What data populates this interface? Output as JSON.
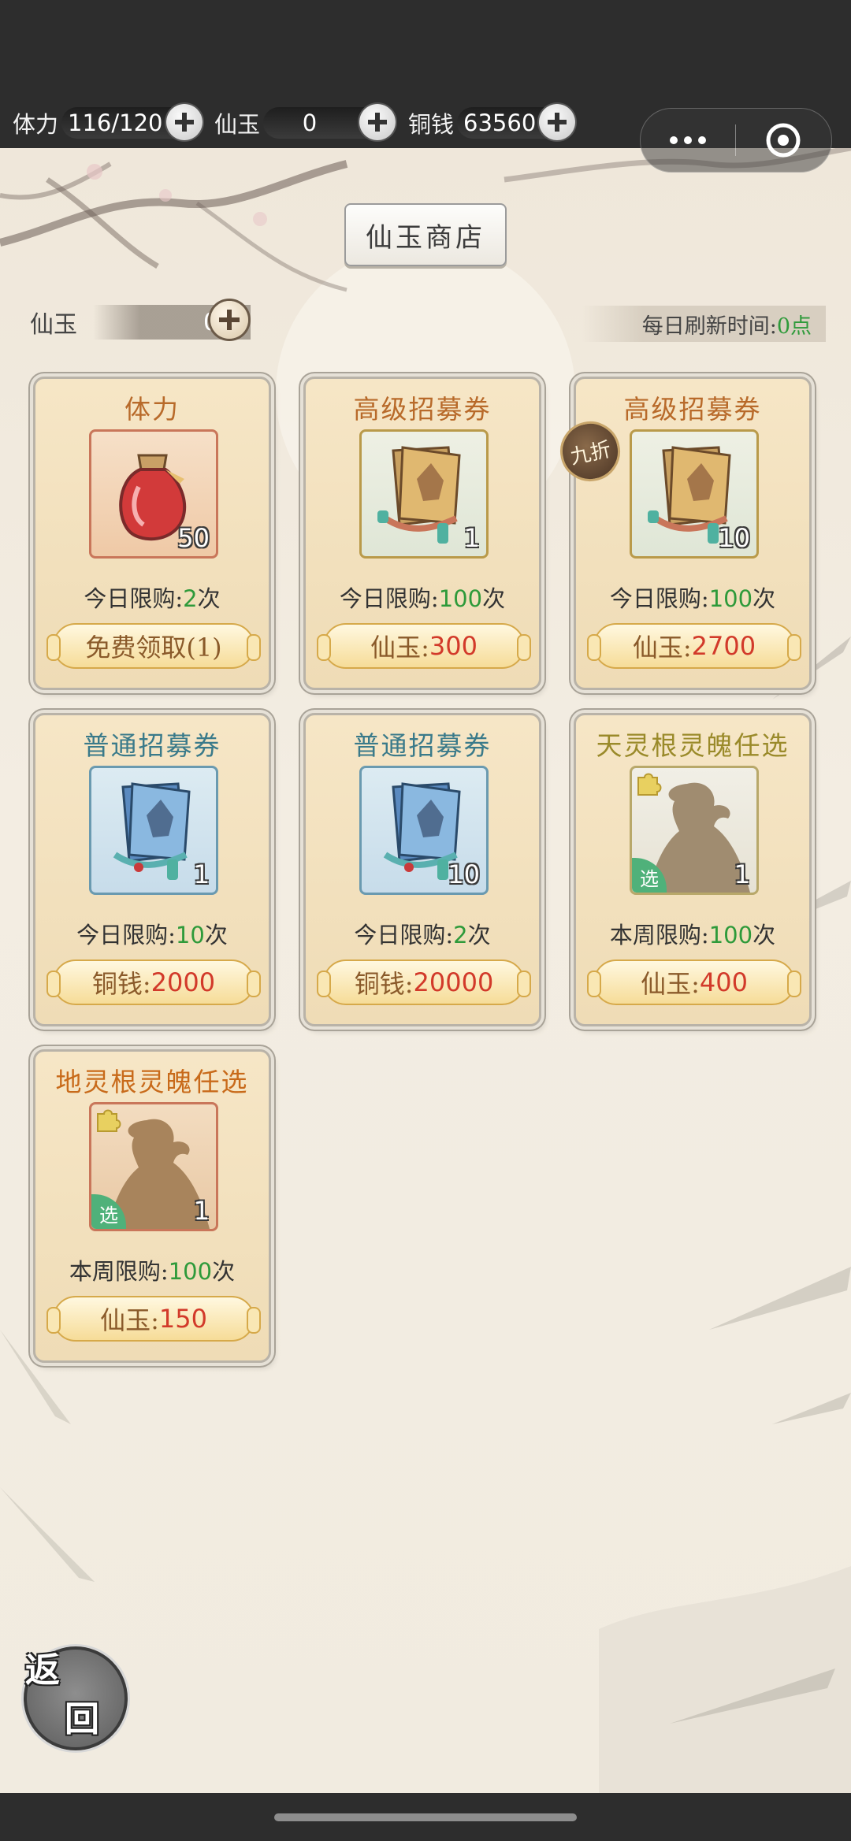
{
  "topbar": {
    "stamina_label": "体力",
    "stamina_value": "116/120",
    "jade_label": "仙玉",
    "jade_value": "0",
    "copper_label": "铜钱",
    "copper_value": "63560"
  },
  "shop": {
    "title": "仙玉商店",
    "jade_label": "仙玉",
    "jade_value": "0",
    "refresh_label": "每日刷新时间:",
    "refresh_value": "0点"
  },
  "items": [
    {
      "name": "体力",
      "qty": "50",
      "limit_prefix": "今日限购:",
      "limit_num": "2",
      "limit_suffix": "次",
      "price_label": "免费领取(1)",
      "price_value": "",
      "title_color": "#b86a2a",
      "icon": "potion-icon"
    },
    {
      "name": "高级招募券",
      "qty": "1",
      "limit_prefix": "今日限购:",
      "limit_num": "100",
      "limit_suffix": "次",
      "price_label": "仙玉:",
      "price_value": "300",
      "title_color": "#b86a2a",
      "icon": "advanced-scroll-icon"
    },
    {
      "name": "高级招募券",
      "qty": "10",
      "limit_prefix": "今日限购:",
      "limit_num": "100",
      "limit_suffix": "次",
      "price_label": "仙玉:",
      "price_value": "2700",
      "title_color": "#b86a2a",
      "icon": "advanced-scroll-icon",
      "badge": "九折"
    },
    {
      "name": "普通招募券",
      "qty": "1",
      "limit_prefix": "今日限购:",
      "limit_num": "10",
      "limit_suffix": "次",
      "price_label": "铜钱:",
      "price_value": "2000",
      "title_color": "#3a7a8a",
      "icon": "normal-scroll-icon"
    },
    {
      "name": "普通招募券",
      "qty": "10",
      "limit_prefix": "今日限购:",
      "limit_num": "2",
      "limit_suffix": "次",
      "price_label": "铜钱:",
      "price_value": "20000",
      "title_color": "#3a7a8a",
      "icon": "normal-scroll-icon"
    },
    {
      "name": "天灵根灵魄任选",
      "qty": "1",
      "limit_prefix": "本周限购:",
      "limit_num": "100",
      "limit_suffix": "次",
      "price_label": "仙玉:",
      "price_value": "400",
      "title_color": "#9a8a2a",
      "icon": "soul-silhouette-icon",
      "select": "选"
    },
    {
      "name": "地灵根灵魄任选",
      "qty": "1",
      "limit_prefix": "本周限购:",
      "limit_num": "100",
      "limit_suffix": "次",
      "price_label": "仙玉:",
      "price_value": "150",
      "title_color": "#c86a1a",
      "icon": "soul-silhouette-icon",
      "select": "选"
    }
  ],
  "back_button": {
    "char1": "返",
    "char2": "回"
  },
  "colors": {
    "limit_green": "#2e9a3a",
    "price_red": "#d23a2a",
    "card_bg": "#f6e6c6"
  }
}
